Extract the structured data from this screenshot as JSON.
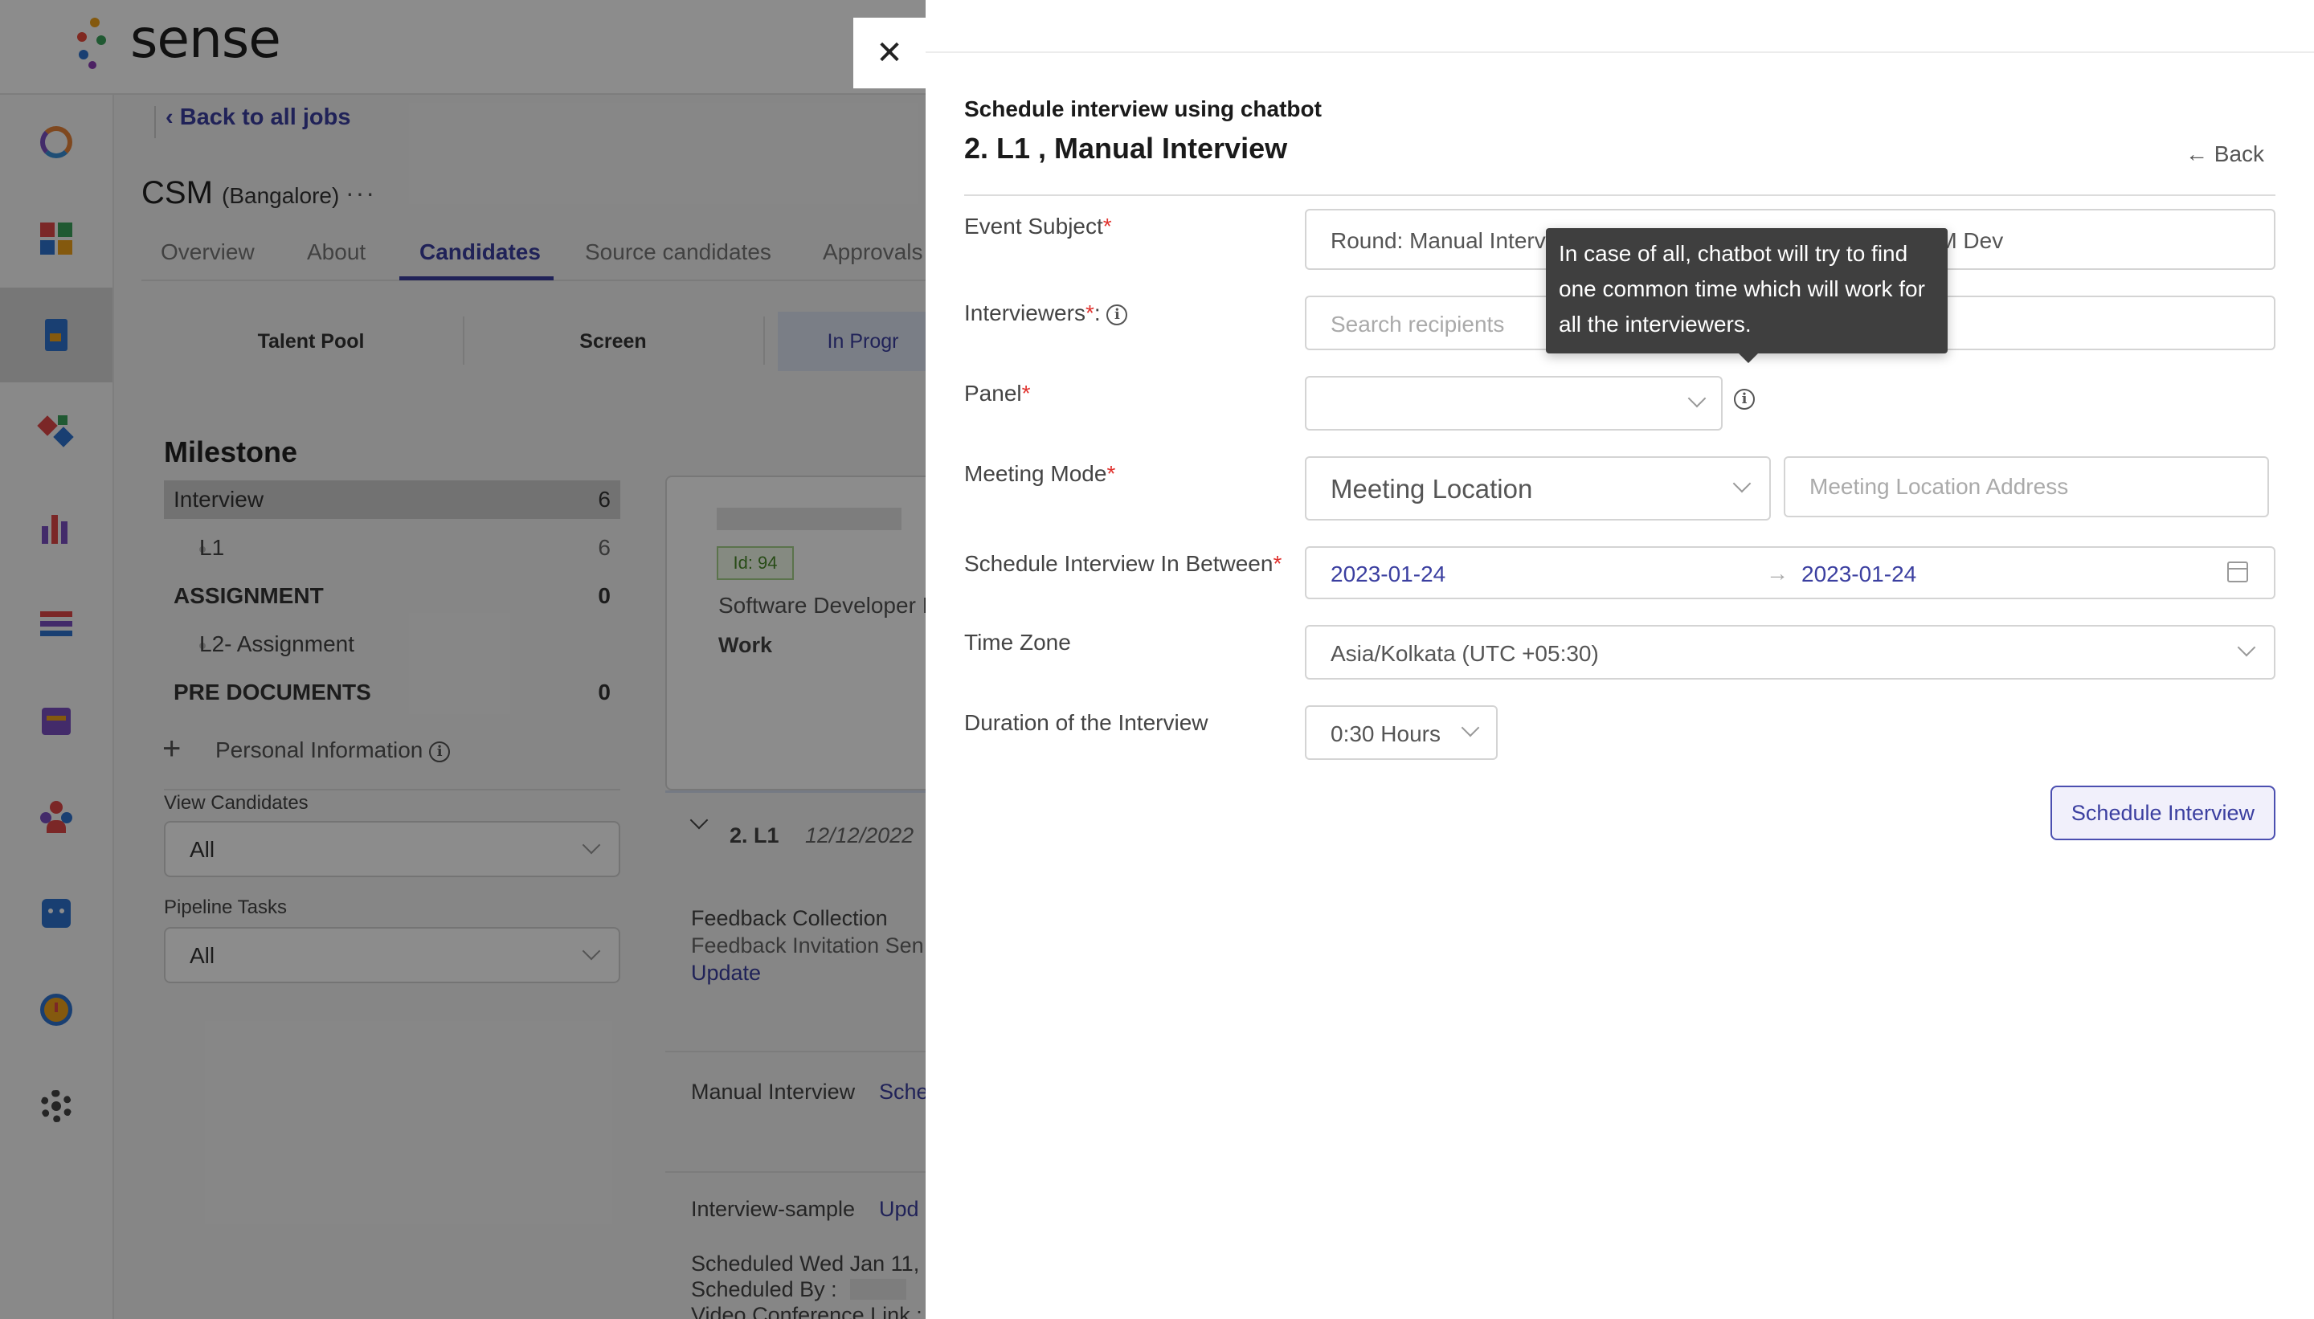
{
  "app": {
    "logo_text": "sense",
    "back_link": "Back to all jobs",
    "job_title": "CSM",
    "job_location": "(Bangalore)",
    "job_more": "···",
    "tabs": [
      {
        "label": "Overview"
      },
      {
        "label": "About"
      },
      {
        "label": "Candidates"
      },
      {
        "label": "Source candidates"
      },
      {
        "label": "Approvals"
      }
    ],
    "stages": [
      {
        "label": "Talent Pool"
      },
      {
        "label": "Screen"
      },
      {
        "label": "In Progr"
      }
    ],
    "milestone": {
      "title": "Milestone",
      "rows": [
        {
          "label": "Interview",
          "count": "6"
        },
        {
          "label": "L1",
          "count": "6"
        },
        {
          "label": "ASSIGNMENT",
          "count": "0"
        },
        {
          "label": "L2- Assignment",
          "count": ""
        },
        {
          "label": "PRE DOCUMENTS",
          "count": "0"
        }
      ]
    },
    "personal_info": "Personal Information",
    "view_candidates": {
      "label": "View Candidates",
      "value": "All"
    },
    "pipeline_tasks": {
      "label": "Pipeline Tasks",
      "value": "All"
    },
    "candidate": {
      "id_badge": "Id: 94",
      "role": "Software Developer I",
      "work_label": "Work",
      "timeline_stage": "2. L1",
      "timeline_date": "12/12/2022",
      "feedback_title": "Feedback Collection",
      "feedback_status": "Feedback Invitation Sen",
      "feedback_update": "Update",
      "manual_interview": "Manual Interview",
      "manual_link": "Sche",
      "interview_sample": "Interview-sample",
      "interview_sample_link": "Upd",
      "scheduled": "Scheduled Wed Jan 11,",
      "scheduled_by": "Scheduled By :",
      "video_link": "Video Conference Link :"
    }
  },
  "drawer": {
    "close_glyph": "✕",
    "subtitle": "Schedule interview using chatbot",
    "title": "2. L1 , Manual Interview",
    "back": "← Back",
    "fields": {
      "event_subject": {
        "label": "Event Subject",
        "value": "Round: Manual Interview | CSM interview: Mithali Shetty | TRM Dev"
      },
      "interviewers": {
        "label": "Interviewers",
        "suffix": ":",
        "placeholder": "Search recipients"
      },
      "panel": {
        "label": "Panel",
        "value": ""
      },
      "meeting_mode": {
        "label": "Meeting Mode",
        "value": "Meeting Location",
        "address_placeholder": "Meeting Location Address"
      },
      "schedule_between": {
        "label": "Schedule Interview In Between",
        "start": "2023-01-24",
        "arrow": "→",
        "end": "2023-01-24"
      },
      "time_zone": {
        "label": "Time Zone",
        "value": "Asia/Kolkata (UTC +05:30)"
      },
      "duration": {
        "label": "Duration of the Interview",
        "value": "0:30 Hours"
      }
    },
    "tooltip": "In case of all, chatbot will try to find one common time which will work for all the interviewers.",
    "schedule_button": "Schedule Interview"
  },
  "colors": {
    "accent": "#3b3fa0",
    "required": "#e0322e",
    "tooltip_bg": "#3f3f3f"
  },
  "icons": {
    "close": "close-icon",
    "info": "info-icon",
    "calendar": "calendar-icon",
    "chevron": "chevron-down-icon"
  }
}
